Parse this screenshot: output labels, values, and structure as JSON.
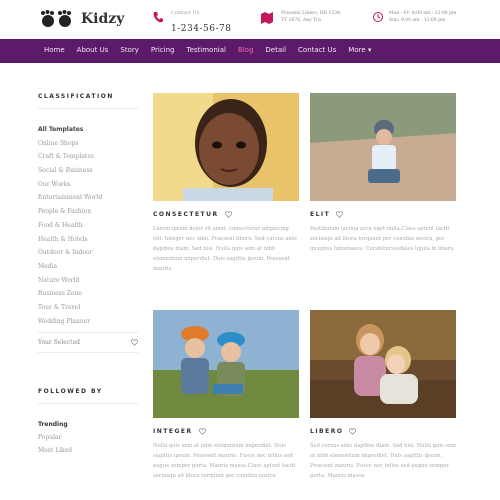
{
  "brand": {
    "name": "Kidzy"
  },
  "header": {
    "contact_label": "Contact Us",
    "phone": "1-234-56-78",
    "address_line1": "Pracezni Libero, Hit 1234,",
    "address_line2": "VT 1876, Any Tra",
    "hours_line1": "Mon - Fr: 8:00 am - 12:00 pm",
    "hours_line2": "Sun: 9:00 am - 12:00 pm"
  },
  "nav": {
    "items": [
      "Home",
      "About Us",
      "Story",
      "Pricing",
      "Testimonial",
      "Blog",
      "Detail",
      "Contact Us",
      "More"
    ],
    "active": "Blog",
    "accent": "#5b1a6a"
  },
  "sidebar": {
    "classification_title": "CLASSIFICATION",
    "categories": [
      "All Templates",
      "Online Shops",
      "Craft & Templates",
      "Social & Business",
      "Our Works",
      "Entertainment World",
      "People & Fashion",
      "Food & Health",
      "Health & Hotels",
      "Outdoor & Indoor",
      "Media",
      "Nature World",
      "Business Zone",
      "Tour & Travel",
      "Wedding Planner"
    ],
    "your_selected": "Your Selected",
    "followed_title": "FOLLOWED BY",
    "followed": [
      "Trending",
      "Popular",
      "Most Liked"
    ]
  },
  "cards": [
    {
      "title": "CONSECTETUR",
      "text": "Lorem ipsum dolor sit amet, consectetur adipiscing elit. Integer nec odio. Praesent libero. Sed cursus ante dapibus diam. Sed nisi. Nulla quis sem at nibh elementum imperdiet. Duis sagittis ipsum. Praesent mauris."
    },
    {
      "title": "ELIT",
      "text": "Vestibulum lacinia arcu eget nulla.Class aptent taciti sociosqu ad litora torquent per conubia nostra, per inceptos himenaeos. Curabiturssodales ligula in libero."
    },
    {
      "title": "INTEGER",
      "text": "Nulla quis sem at nibh elementum imperdiet. Duis sagittis ipsum. Praesent mauris. Fusce nec tellus sed augue semper porta. Mauris massa.Class aptent taciti sociosqu ad litora torquent per conubia nostra."
    },
    {
      "title": "LIBERO",
      "text": "Sed cursus ante dapibus diam. Sed nisi. Nulla quis sem at nibh elementum imperdiet. Duis sagittis ipsum. Praesent mauris. Fusce nec tellus sed augue semper porta. Mauris massa."
    }
  ]
}
